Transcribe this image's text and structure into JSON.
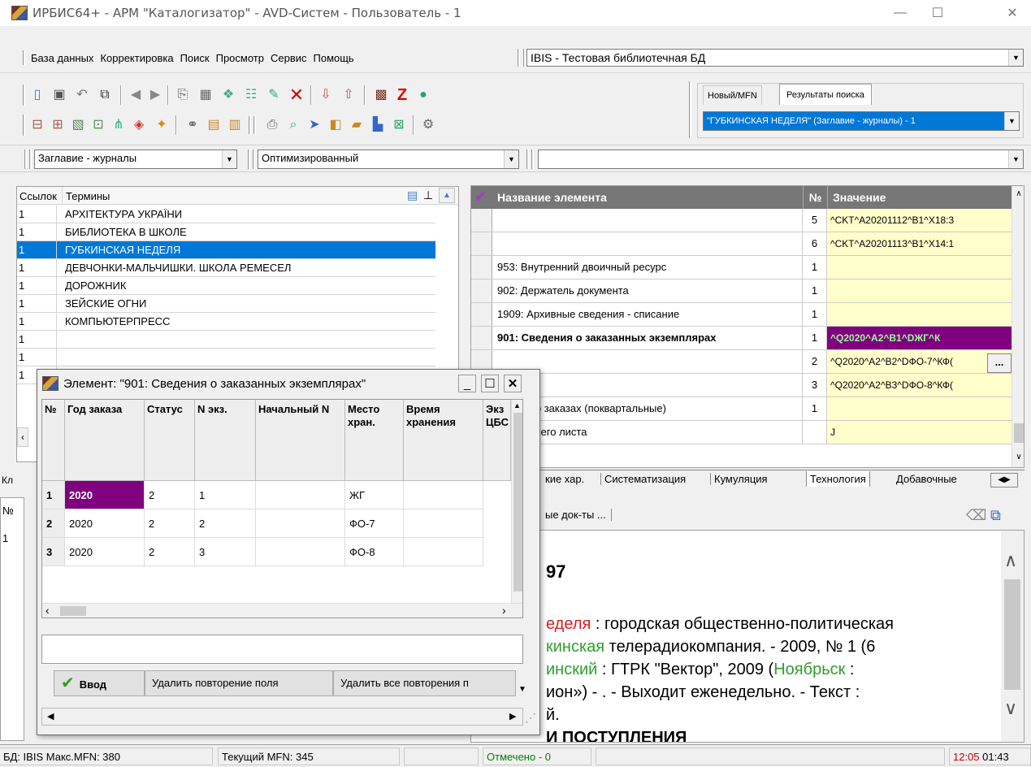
{
  "window": {
    "title": "ИРБИС64+ - АРМ \"Каталогизатор\" - AVD-Систем - Пользователь - 1",
    "min_glyph": "—",
    "max_glyph": "☐",
    "close_glyph": "✕"
  },
  "menu": {
    "items": [
      "База данных",
      "Корректировка",
      "Поиск",
      "Просмотр",
      "Сервис",
      "Помощь"
    ],
    "database_combo": "IBIS - Тестовая библиотечная БД"
  },
  "search_tabs": {
    "tab1": "Новый/MFN",
    "tab2": "Результаты поиска",
    "result_combo": "\"ГУБКИНСКАЯ НЕДЕЛЯ\" (Заглавие - журналы) - 1"
  },
  "filters": {
    "dictionary": "Заглавие - журналы",
    "format": "Оптимизированный",
    "third": ""
  },
  "terms_list": {
    "col_refs": "Ссылок",
    "col_terms": "Термины",
    "rows": [
      {
        "refs": "1",
        "term": "АРХІТЕКТУРА УКРАЇНИ"
      },
      {
        "refs": "1",
        "term": "БИБЛИОТЕКА В ШКОЛЕ"
      },
      {
        "refs": "1",
        "term": "ГУБКИНСКАЯ НЕДЕЛЯ"
      },
      {
        "refs": "1",
        "term": "ДЕВЧОНКИ-МАЛЬЧИШКИ. ШКОЛА РЕМЕСЕЛ"
      },
      {
        "refs": "1",
        "term": "ДОРОЖНИК"
      },
      {
        "refs": "1",
        "term": "ЗЕЙСКИЕ ОГНИ"
      },
      {
        "refs": "1",
        "term": "КОМПЬЮТЕРПРЕСС"
      },
      {
        "refs": "1",
        "term": ""
      },
      {
        "refs": "1",
        "term": ""
      },
      {
        "refs": "1",
        "term": ""
      }
    ],
    "selected_index": 2
  },
  "left_bottom": {
    "tab_label": "Кл",
    "col_label": "№",
    "row_first": "1"
  },
  "fields_grid": {
    "col_name": "Название элемента",
    "col_no": "№",
    "col_value": "Значение",
    "rows": [
      {
        "name": "",
        "no": "5",
        "value": "^CKT^A20201112^B1^X18:3"
      },
      {
        "name": "",
        "no": "6",
        "value": "^CKT^A20201113^B1^X14:1"
      },
      {
        "name": "953: Внутренний двоичный ресурс",
        "no": "1",
        "value": ""
      },
      {
        "name": "902: Держатель документа",
        "no": "1",
        "value": ""
      },
      {
        "name": "1909: Архивные сведения - списание",
        "no": "1",
        "value": ""
      },
      {
        "name": "901: Сведения  о заказанных экземплярах",
        "no": "1",
        "value": "^Q2020^A2^B1^DЖГ^К"
      },
      {
        "name": "",
        "no": "2",
        "value": "^Q2020^A2^B2^DФО-7^КФ("
      },
      {
        "name": "",
        "no": "3",
        "value": "^Q2020^A2^B3^DФО-8^КФ("
      },
      {
        "name": "едения  о заказах (поквартальные)",
        "no": "1",
        "value": ""
      },
      {
        "name": "ия рабочего листа",
        "no": "",
        "value": "J"
      }
    ],
    "ellipsis": "..."
  },
  "field_tabs": [
    "кие хар.",
    "Систематизация",
    "Кумуляция",
    "Технология",
    "Добавочные"
  ],
  "doc_tabs": {
    "label": "ые док-ты ..."
  },
  "document": {
    "heading": "97",
    "line1_red": "еделя",
    "line1_rest": " : городская общественно-политическая",
    "line2_green": "кинская",
    "line2_rest": " телерадиокомпания. - 2009, № 1 (6",
    "line3_green": "инский",
    "line3_mid": " : ГТРК \"Вектор\", 2009 (",
    "line3_green2": "Ноябрьск",
    "line3_end": " :",
    "line4": "ион») - . - Выходит еженедельно. - Текст :",
    "line5": "й.",
    "line6": "И ПОСТУПЛЕНИЯ"
  },
  "dialog": {
    "title": "Элемент:  \"901: Сведения  о заказанных экземплярах\"",
    "columns": [
      "№",
      "Год заказа",
      "Статус",
      "N экз.",
      "Начальный N",
      "Место хран.",
      "Время хранения",
      "Экз ЦБС"
    ],
    "rows": [
      {
        "n": "1",
        "year": "2020",
        "status": "2",
        "copies": "1",
        "start": "",
        "place": "ЖГ",
        "time": ""
      },
      {
        "n": "2",
        "year": "2020",
        "status": "2",
        "copies": "2",
        "start": "",
        "place": "ФО-7",
        "time": ""
      },
      {
        "n": "3",
        "year": "2020",
        "status": "2",
        "copies": "3",
        "start": "",
        "place": "ФО-8",
        "time": ""
      }
    ],
    "btn_enter": "Ввод",
    "btn_delete_repeat": "Удалить повторение поля",
    "btn_delete_all": "Удалить все повторения п"
  },
  "statusbar": {
    "db": "БД: IBIS Макс.MFN: 380",
    "current": "Текущий MFN: 345",
    "marked": "Отмечено - 0",
    "time_hm": "12:05",
    "time_rest": " 01:43"
  },
  "colors": {
    "selection_blue": "#0078d7",
    "grid_header_gray": "#777777",
    "value_yellow": "#ffffcc",
    "field_value_purple": "#800080",
    "marked_green": "#008000",
    "doc_red": "#d42020",
    "doc_green": "#2e9e2e"
  }
}
